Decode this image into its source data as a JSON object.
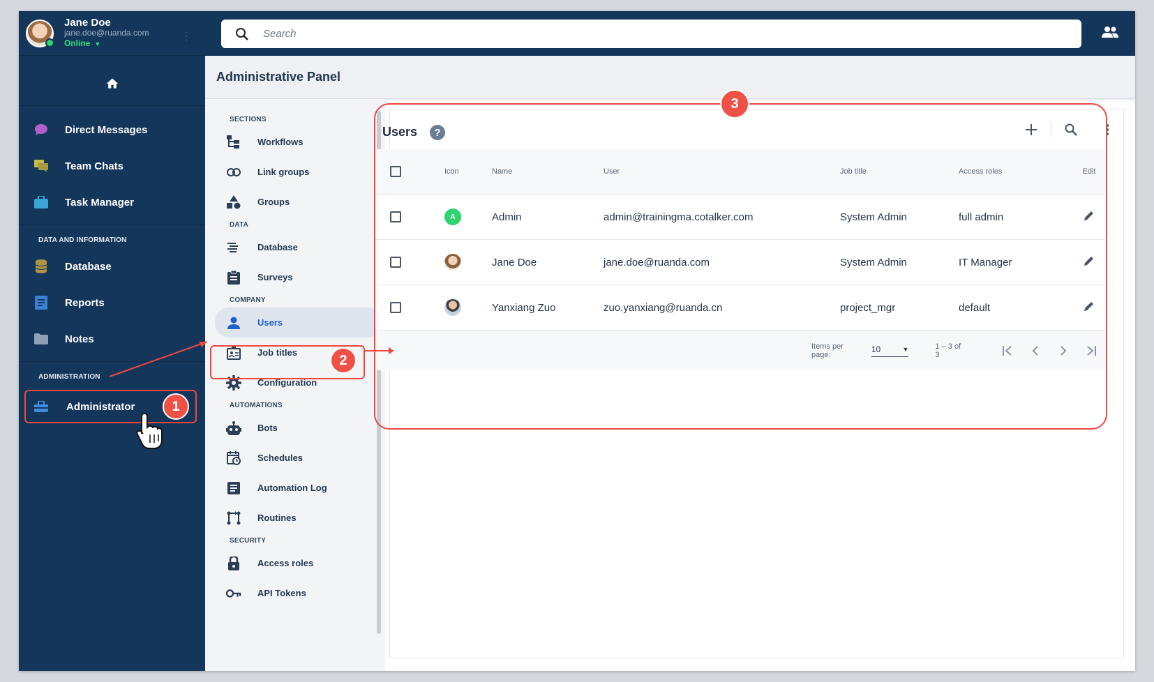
{
  "user": {
    "name": "Jane Doe",
    "email": "jane.doe@ruanda.com",
    "status": "Online"
  },
  "sidebar": {
    "items": [
      {
        "label": "Direct Messages",
        "icon": "chat-bubble-icon"
      },
      {
        "label": "Team Chats",
        "icon": "team-chat-icon"
      },
      {
        "label": "Task Manager",
        "icon": "briefcase-icon"
      }
    ],
    "data_section": "DATA AND INFORMATION",
    "data_items": [
      {
        "label": "Database",
        "icon": "database-icon"
      },
      {
        "label": "Reports",
        "icon": "reports-icon"
      },
      {
        "label": "Notes",
        "icon": "folder-icon"
      }
    ],
    "admin_section": "ADMINISTRATION",
    "admin_item": "Administrator"
  },
  "search": {
    "placeholder": "Search"
  },
  "panel": {
    "title": "Administrative Panel"
  },
  "menu": {
    "sections_label": "SECTIONS",
    "sections": [
      "Workflows",
      "Link groups",
      "Groups"
    ],
    "data_label": "DATA",
    "data": [
      "Database",
      "Surveys"
    ],
    "company_label": "COMPANY",
    "company": [
      "Users",
      "Job titles",
      "Configuration"
    ],
    "automations_label": "AUTOMATIONS",
    "automations": [
      "Bots",
      "Schedules",
      "Automation Log",
      "Routines"
    ],
    "security_label": "SECURITY",
    "security": [
      "Access roles",
      "API Tokens"
    ]
  },
  "callouts": [
    "1",
    "2",
    "3"
  ],
  "users_table": {
    "title": "Users",
    "help": "?",
    "columns": [
      "Icon",
      "Name",
      "User",
      "Job title",
      "Access roles",
      "Edit"
    ],
    "rows": [
      {
        "avatar": "A",
        "name": "Admin",
        "user": "admin@trainingma.cotalker.com",
        "job": "System Admin",
        "role": "full admin"
      },
      {
        "avatar": "",
        "name": "Jane Doe",
        "user": "jane.doe@ruanda.com",
        "job": "System Admin",
        "role": "IT Manager"
      },
      {
        "avatar": "",
        "name": "Yanxiang Zuo",
        "user": "zuo.yanxiang@ruanda.cn",
        "job": "project_mgr",
        "role": "default"
      }
    ],
    "footer": {
      "items_per_page_label": "Items per page:",
      "items_per_page": "10",
      "range": "1 – 3 of 3"
    }
  },
  "colors": {
    "sidebar_bg": "#14365a",
    "callout": "#ef5146",
    "online": "#2ee37a",
    "active_link": "#1f61c9"
  }
}
